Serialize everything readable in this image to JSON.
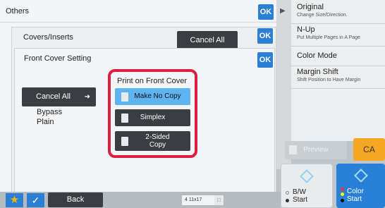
{
  "dialogs": {
    "others": {
      "title": "Others",
      "ok_label": "OK"
    },
    "covers": {
      "title": "Covers/Inserts",
      "cancel_all_label": "Cancel All",
      "ok_label": "OK"
    },
    "front_cover": {
      "title": "Front Cover Setting",
      "ok_label": "OK",
      "cancel_all_label": "Cancel All",
      "tray": "Bypass",
      "paper_type": "Plain",
      "print_group_label": "Print on Front Cover",
      "options": [
        {
          "label": "Make No Copy",
          "selected": true
        },
        {
          "label": "Simplex",
          "selected": false
        },
        {
          "label": "2-Sided Copy",
          "selected": false
        }
      ]
    }
  },
  "right_panel": {
    "items": [
      {
        "title": "Original",
        "sub": "Change Size/Direction."
      },
      {
        "title": "N-Up",
        "sub": "Put Multiple Pages in A Page"
      },
      {
        "title": "Color Mode",
        "sub": ""
      },
      {
        "title": "Margin Shift",
        "sub": "Shift Position to Have Margin"
      }
    ]
  },
  "controls": {
    "preview_label": "Preview",
    "ca_label": "CA",
    "bw_start_label": "B/W\nStart",
    "color_start_label": "Color\nStart"
  },
  "bottom": {
    "back_label": "Back",
    "paper_indicator": "4   11x17"
  },
  "colors": {
    "accent_blue": "#2b7fd4",
    "selected_blue": "#5eb3f0",
    "highlight_red": "#d9213f",
    "ca_orange": "#f5a623",
    "dark_button": "#3a3d42"
  }
}
